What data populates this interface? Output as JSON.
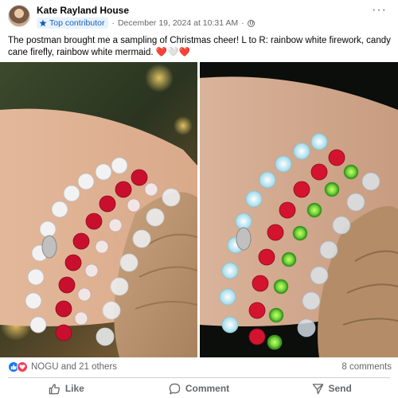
{
  "post": {
    "author": "Kate Rayland House",
    "badge": "Top contributor",
    "meta_separator": "·",
    "timestamp": "December 19, 2024 at 10:31 AM",
    "meta_separator2": "·",
    "more_label": "···",
    "caption": "The postman brought me a sampling of Christmas cheer! L to R: rainbow white firework, candy cane firefly, rainbow white mermaid.",
    "caption_emojis": [
      "❤️",
      "🤍",
      "❤️"
    ]
  },
  "photos": [
    {
      "alt": "three beaded bracelets on a wrist",
      "icon": "bracelet-photo"
    },
    {
      "alt": "same bracelets glowing in the dark",
      "icon": "glow-photo"
    }
  ],
  "engagement": {
    "reactions_text": "NOGU and 21 others",
    "comments_text": "8 comments",
    "reaction_icons": [
      "like-icon",
      "love-icon"
    ]
  },
  "actions": {
    "like": "Like",
    "comment": "Comment",
    "send": "Send"
  },
  "colors": {
    "accent": "#1877f2",
    "love": "#f33e58",
    "badge_bg": "#e7f3ff",
    "muted": "#65676b"
  }
}
